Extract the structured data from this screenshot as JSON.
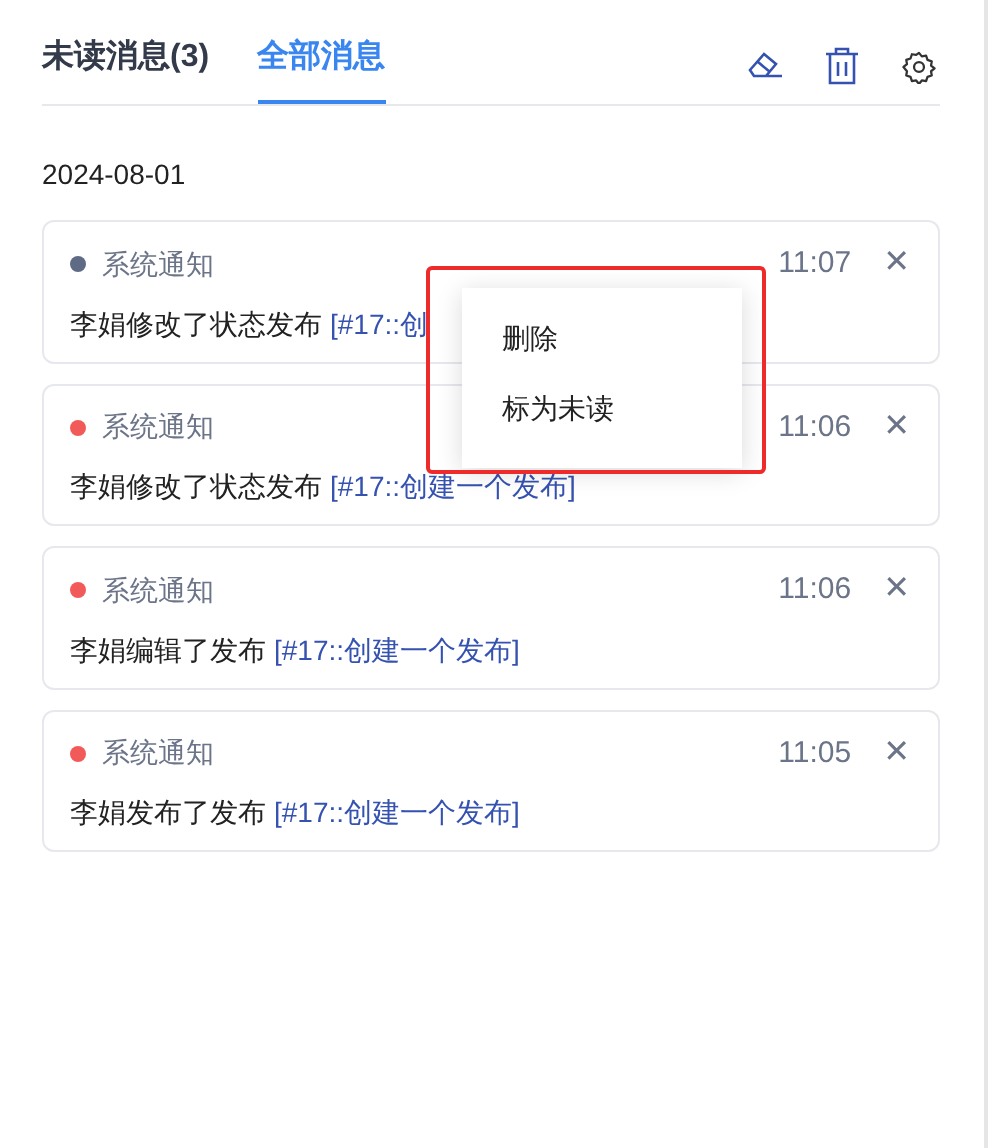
{
  "tabs": [
    {
      "label": "未读消息(3)",
      "selected": false
    },
    {
      "label": "全部消息",
      "selected": true
    }
  ],
  "date": "2024-08-01",
  "messages": [
    {
      "source": "系统通知",
      "color": "#5f6b85",
      "time": "11:07",
      "text": "李娟修改了状态发布",
      "link": "[#17::创"
    },
    {
      "source": "系统通知",
      "color": "#f25a5a",
      "time": "11:06",
      "text": "李娟修改了状态发布",
      "link": "[#17::创建一个发布]"
    },
    {
      "source": "系统通知",
      "color": "#f25a5a",
      "time": "11:06",
      "text": "李娟编辑了发布",
      "link": "[#17::创建一个发布]"
    },
    {
      "source": "系统通知",
      "color": "#f25a5a",
      "time": "11:05",
      "text": "李娟发布了发布",
      "link": "[#17::创建一个发布]"
    }
  ],
  "context_menu": {
    "items": [
      "删除",
      "标为未读"
    ]
  },
  "close_glyph": "✕"
}
